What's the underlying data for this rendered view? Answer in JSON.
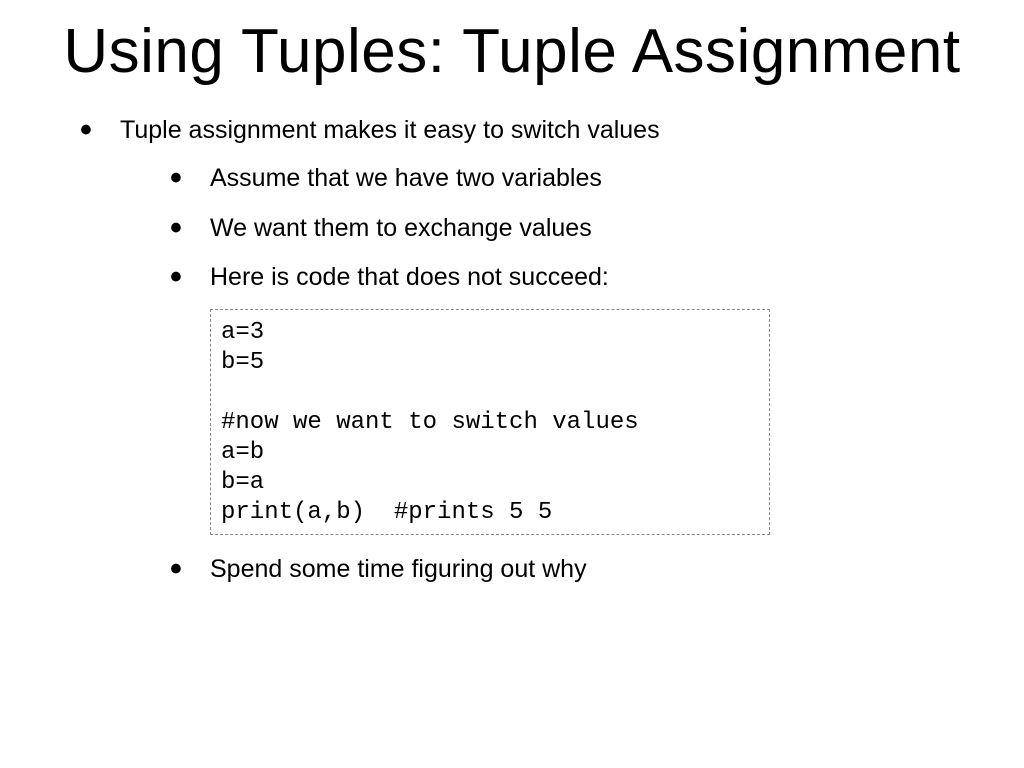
{
  "title": "Using Tuples: Tuple Assignment",
  "bullets": {
    "main": "Tuple assignment makes it easy to switch values",
    "sub": [
      "Assume that we have two variables",
      "We want them to exchange values",
      "Here is code that does not succeed:"
    ],
    "final": "Spend some time figuring out why"
  },
  "code": "a=3\nb=5\n\n#now we want to switch values\na=b\nb=a\nprint(a,b)  #prints 5 5"
}
